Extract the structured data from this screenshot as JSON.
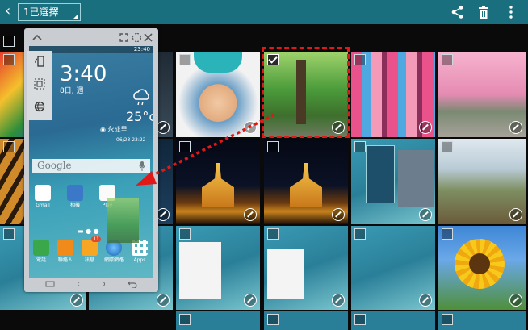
{
  "toolbar": {
    "selected_label": "1已選擇",
    "share_icon": "share-icon",
    "delete_icon": "trash-icon",
    "more_icon": "more-vertical-icon",
    "bar_color": "#1a6f7e"
  },
  "float_window": {
    "status_time": "23:40",
    "clock": "3:40",
    "date": "8日, 週一",
    "temperature": "25°c",
    "location": "永成里",
    "updated": "06/23 23:22",
    "search_brand": "Google",
    "apps_row1": [
      "Gmail",
      "相機",
      "Play"
    ],
    "apps_dock": [
      "電話",
      "聯絡人",
      "訊息",
      "網際網路",
      "Apps"
    ],
    "badge": "11"
  },
  "colors": {
    "selection_frame": "#e01818",
    "accent": "#1a6f7e"
  }
}
